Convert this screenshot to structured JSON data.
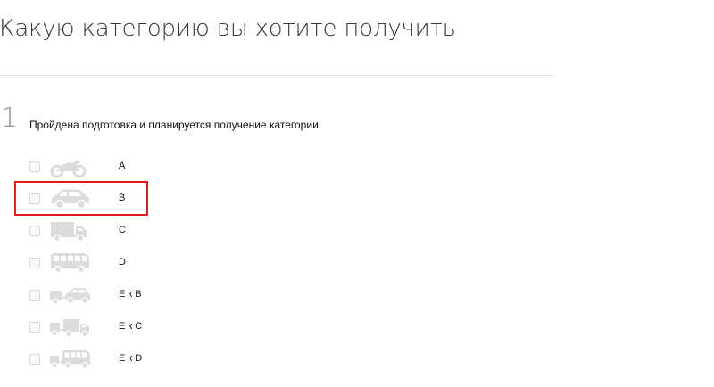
{
  "header": {
    "title": "Какую категорию вы хотите получить"
  },
  "step": {
    "number": "1",
    "text": "Пройдена подготовка и планируется получение категории"
  },
  "categories": [
    {
      "label": "A",
      "icon": "motorcycle-icon",
      "checked": false
    },
    {
      "label": "B",
      "icon": "car-icon",
      "checked": false
    },
    {
      "label": "C",
      "icon": "truck-icon",
      "checked": false
    },
    {
      "label": "D",
      "icon": "bus-icon",
      "checked": false
    },
    {
      "label": "E к B",
      "icon": "car-with-trailer-icon",
      "checked": false
    },
    {
      "label": "E к C",
      "icon": "truck-with-trailer-icon",
      "checked": false
    },
    {
      "label": "E к D",
      "icon": "bus-with-trailer-icon",
      "checked": false
    }
  ],
  "colors": {
    "icon": "#dcdcdc",
    "highlight": "#e01b1b",
    "divider": "#e3e3e3"
  }
}
